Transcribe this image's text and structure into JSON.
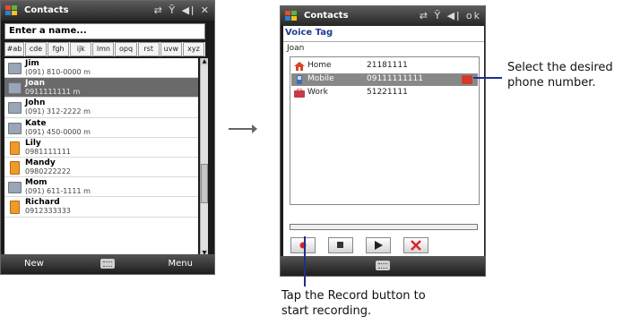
{
  "phone1": {
    "title": "Contacts",
    "search_placeholder": "Enter a name...",
    "tabs": [
      "#ab",
      "cde",
      "fgh",
      "ijk",
      "lmn",
      "opq",
      "rst",
      "uvw",
      "xyz"
    ],
    "contacts": [
      {
        "name": "Jim",
        "phone": "(091) 810-0000  m",
        "icon": "contact-card-icon"
      },
      {
        "name": "Joan",
        "phone": "0911111111  m",
        "icon": "contact-card-icon",
        "selected": true
      },
      {
        "name": "John",
        "phone": "(091) 312-2222  m",
        "icon": "contact-card-icon"
      },
      {
        "name": "Kate",
        "phone": "(091) 450-0000  m",
        "icon": "contact-card-icon"
      },
      {
        "name": "Lily",
        "phone": "0981111111",
        "icon": "sim-contact-icon"
      },
      {
        "name": "Mandy",
        "phone": "0980222222",
        "icon": "sim-contact-icon"
      },
      {
        "name": "Mom",
        "phone": "(091) 611-1111  m",
        "icon": "contact-card-icon"
      },
      {
        "name": "Richard",
        "phone": "0912333333",
        "icon": "sim-contact-icon"
      }
    ],
    "softkey_left": "New",
    "softkey_right": "Menu"
  },
  "phone2": {
    "title": "Contacts",
    "header": "Voice Tag",
    "contact_name": "Joan",
    "numbers": [
      {
        "label": "Home",
        "value": "21181111",
        "icon": "home-icon"
      },
      {
        "label": "Mobile",
        "value": "09111111111",
        "icon": "mobile-phone-icon",
        "selected": true
      },
      {
        "label": "Work",
        "value": "51221111",
        "icon": "work-icon"
      }
    ]
  },
  "callouts": {
    "select_number": [
      "Select the desired",
      "phone number."
    ],
    "record_button": [
      "Tap the Record button to",
      "start recording."
    ]
  },
  "colors": {
    "header_blue": "#1e3d8f",
    "record_red": "#d8262a",
    "leader_line": "#1f2f8a"
  }
}
